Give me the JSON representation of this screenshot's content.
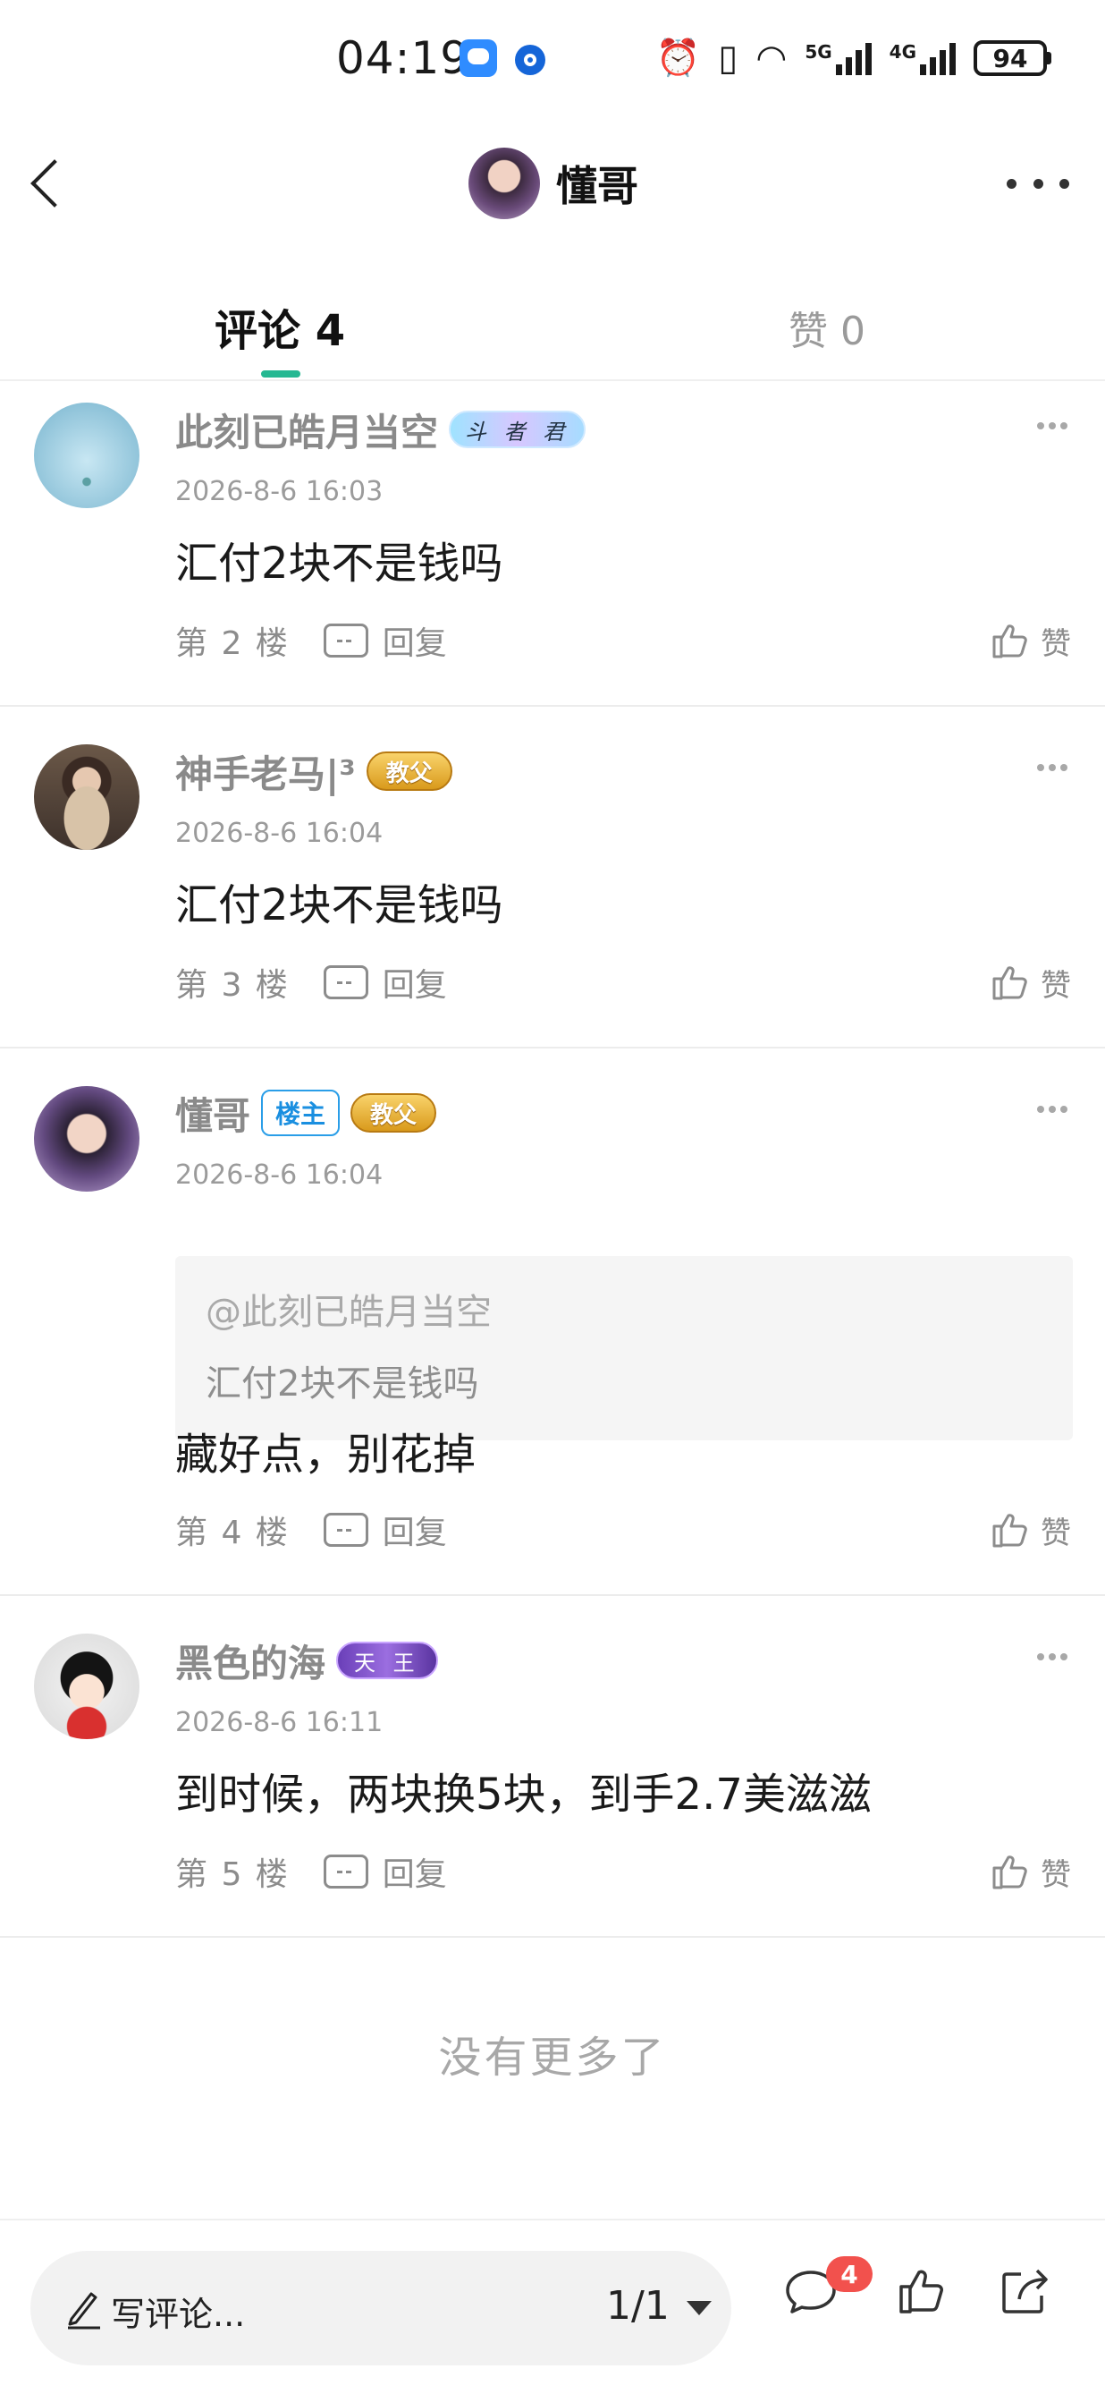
{
  "status_bar": {
    "time": "04:19",
    "network_1": "5G",
    "network_2": "4G",
    "battery": "94"
  },
  "header": {
    "title": "懂哥"
  },
  "tabs": {
    "comments": "评论 4",
    "likes": "赞 0"
  },
  "comments": [
    {
      "name": "此刻已皓月当空",
      "badge": "斗 者 君",
      "time": "2026-8-6 16:03",
      "text": "汇付2块不是钱吗",
      "floor": "第 2 楼",
      "reply": "回复",
      "like": "赞"
    },
    {
      "name": "神手老马|³",
      "badge": "教父",
      "time": "2026-8-6 16:04",
      "text": "汇付2块不是钱吗",
      "floor": "第 3 楼",
      "reply": "回复",
      "like": "赞"
    },
    {
      "name": "懂哥",
      "owner_badge": "楼主",
      "badge": "教父",
      "time": "2026-8-6 16:04",
      "quote_at": "@此刻已皓月当空",
      "quote_text": "汇付2块不是钱吗",
      "text": "藏好点，别花掉",
      "floor": "第 4 楼",
      "reply": "回复",
      "like": "赞"
    },
    {
      "name": "黑色的海",
      "badge": "天 王",
      "time": "2026-8-6 16:11",
      "text": "到时候，两块换5块，到手2.7美滋滋",
      "floor": "第 5 楼",
      "reply": "回复",
      "like": "赞"
    }
  ],
  "footer_note": "没有更多了",
  "bottom_bar": {
    "write_placeholder": "写评论...",
    "page_indicator": "1/1",
    "comment_count": "4"
  },
  "icons": {
    "back": "chevron-left-icon",
    "more": "more-horizontal-icon",
    "reply": "reply-icon",
    "like": "thumbs-up-icon",
    "pen": "pen-icon",
    "comment": "comment-bubble-icon",
    "share": "share-icon"
  },
  "colors": {
    "accent": "#25b892",
    "owner_badge": "#1a8fe0",
    "notification": "#f2514d"
  }
}
